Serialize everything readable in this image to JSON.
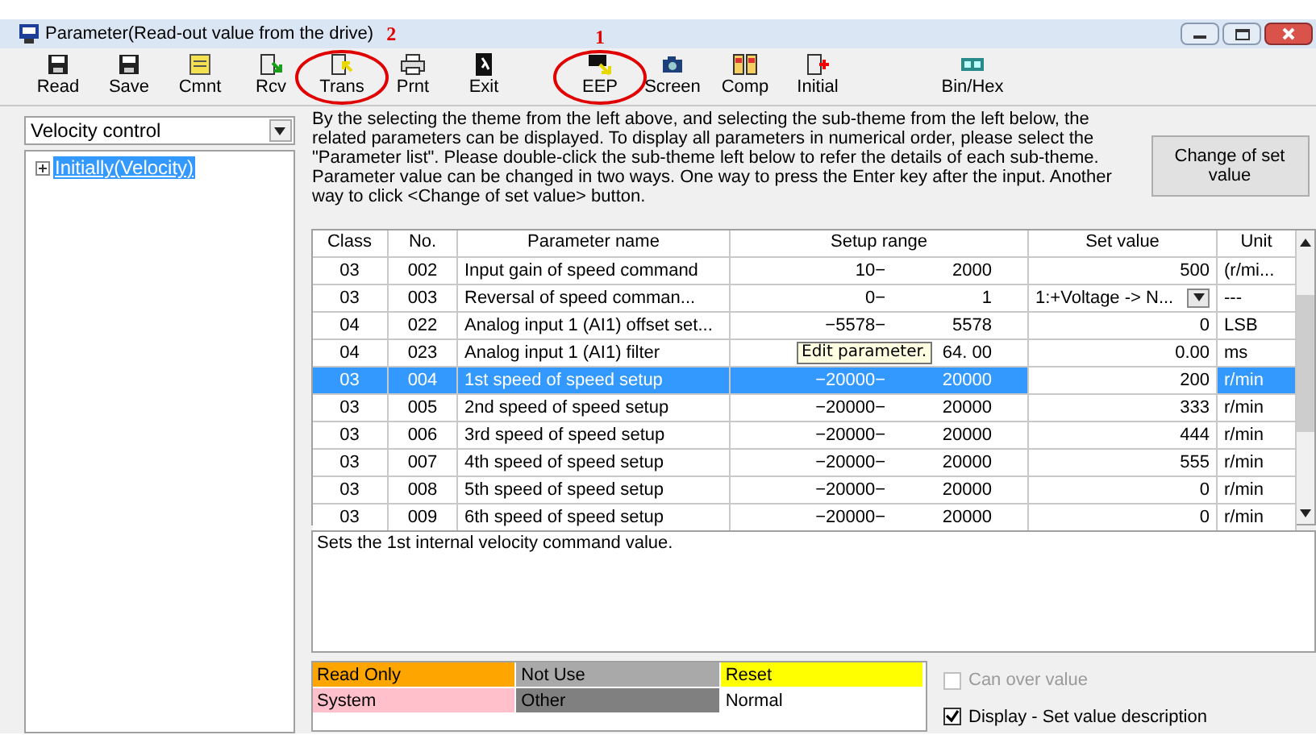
{
  "window": {
    "title": "Parameter(Read-out value from the drive)"
  },
  "annotations": [
    "2",
    "1"
  ],
  "toolbar": [
    {
      "label": "Read",
      "circled": false
    },
    {
      "label": "Save",
      "circled": false
    },
    {
      "label": "Cmnt",
      "circled": false
    },
    {
      "label": "Rcv",
      "circled": false
    },
    {
      "label": "Trans",
      "circled": true
    },
    {
      "label": "Prnt",
      "circled": false
    },
    {
      "label": "Exit",
      "circled": false
    },
    {
      "label": "EEP",
      "circled": true
    },
    {
      "label": "Screen",
      "circled": false
    },
    {
      "label": "Comp",
      "circled": false
    },
    {
      "label": "Initial",
      "circled": false
    },
    {
      "label": "Bin/Hex",
      "circled": false
    }
  ],
  "theme_select": {
    "value": "Velocity control"
  },
  "tree": [
    {
      "label": "Initially(Velocity)",
      "selected": true,
      "expanded": false
    }
  ],
  "instructions": "By the selecting the theme from the left above, and selecting the sub-theme from the left below, the related parameters can be displayed. To display all parameters in numerical order, please select the \"Parameter list\". Please double-click the sub-theme left below to refer the details of each sub-theme. Parameter value can be changed in two ways. One way to press the Enter key after the input. Another way to click <Change of set value> button.",
  "change_button": "Change of set value",
  "table": {
    "columns": [
      "Class",
      "No.",
      "Parameter name",
      "Setup range",
      "Set value",
      "Unit"
    ],
    "rows": [
      {
        "class": "03",
        "no": "002",
        "name": "Input gain of speed command",
        "range_min": "10−",
        "range_max": "2000",
        "kind": "text",
        "value": "500",
        "unit": "(r/mi...",
        "selected": false
      },
      {
        "class": "03",
        "no": "003",
        "name": "Reversal of speed comman...",
        "range_min": "0−",
        "range_max": "1",
        "kind": "select",
        "value": "1:+Voltage -> N...",
        "unit": "---",
        "selected": false
      },
      {
        "class": "04",
        "no": "022",
        "name": "Analog input 1 (AI1) offset set...",
        "range_min": "−5578−",
        "range_max": "5578",
        "kind": "text",
        "value": "0",
        "unit": "LSB",
        "selected": false
      },
      {
        "class": "04",
        "no": "023",
        "name": "Analog input 1 (AI1) filter",
        "tooltip": "Edit parameter.",
        "range_max": "64. 00",
        "kind": "text",
        "value": "0.00",
        "unit": "ms",
        "selected": false
      },
      {
        "class": "03",
        "no": "004",
        "name": "1st speed of speed setup",
        "range_min": "−20000−",
        "range_max": "20000",
        "kind": "text",
        "value": "200",
        "unit": "r/min",
        "selected": true
      },
      {
        "class": "03",
        "no": "005",
        "name": "2nd speed of speed setup",
        "range_min": "−20000−",
        "range_max": "20000",
        "kind": "text",
        "value": "333",
        "unit": "r/min",
        "selected": false
      },
      {
        "class": "03",
        "no": "006",
        "name": "3rd speed of speed setup",
        "range_min": "−20000−",
        "range_max": "20000",
        "kind": "text",
        "value": "444",
        "unit": "r/min",
        "selected": false
      },
      {
        "class": "03",
        "no": "007",
        "name": "4th speed of speed setup",
        "range_min": "−20000−",
        "range_max": "20000",
        "kind": "text",
        "value": "555",
        "unit": "r/min",
        "selected": false
      },
      {
        "class": "03",
        "no": "008",
        "name": "5th speed of speed setup",
        "range_min": "−20000−",
        "range_max": "20000",
        "kind": "text",
        "value": "0",
        "unit": "r/min",
        "selected": false
      },
      {
        "class": "03",
        "no": "009",
        "name": "6th speed of speed setup",
        "range_min": "−20000−",
        "range_max": "20000",
        "kind": "text",
        "value": "0",
        "unit": "r/min",
        "selected": false
      }
    ]
  },
  "description": "Sets the 1st internal velocity command value.",
  "legend": [
    {
      "label": "Read Only",
      "color": "#ffa500"
    },
    {
      "label": "Not Use",
      "color": "#a9a9a9"
    },
    {
      "label": "Reset",
      "color": "#ffff00"
    },
    {
      "label": "System",
      "color": "#ffc0cb"
    },
    {
      "label": "Other",
      "color": "#808080"
    },
    {
      "label": "Normal",
      "color": "#ffffff"
    }
  ],
  "options": [
    {
      "label": "Can over value",
      "checked": false,
      "disabled": true
    },
    {
      "label": "Display - Set value description",
      "checked": true,
      "disabled": false
    }
  ]
}
